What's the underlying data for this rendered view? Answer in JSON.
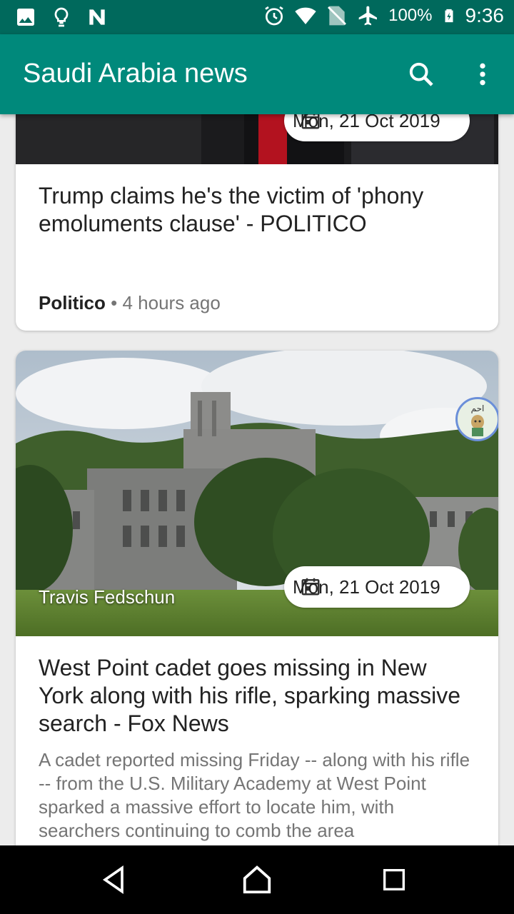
{
  "status_bar": {
    "battery_percent": "100%",
    "time": "9:36",
    "left_icons": [
      "image-icon",
      "lightbulb-icon",
      "n-icon"
    ],
    "right_icons": [
      "alarm-icon",
      "wifi-icon",
      "no-sim-icon",
      "airplane-icon",
      "battery-charging-icon"
    ]
  },
  "app_bar": {
    "title": "Saudi Arabia news",
    "actions": [
      "search-icon",
      "more-vert-icon"
    ],
    "color": "#00897b",
    "status_color": "#00695c"
  },
  "articles": [
    {
      "date": "Mon, 21 Oct 2019",
      "title": "Trump claims he's the victim of 'phony emoluments clause' - POLITICO",
      "source": "Politico",
      "separator": "•",
      "time_ago": "4 hours ago"
    },
    {
      "date": "Mon, 21 Oct 2019",
      "image_caption": "Travis Fedschun",
      "avatar_label": "احم",
      "title": "West Point cadet goes missing in New York along with his rifle, sparking massive search - Fox News",
      "description": "A cadet reported missing Friday -- along with his rifle -- from the U.S. Military Academy at West Point sparked a massive effort to locate him, with searchers continuing to comb the area"
    }
  ],
  "nav_bar": {
    "buttons": [
      "back-icon",
      "home-icon",
      "recents-icon"
    ]
  }
}
